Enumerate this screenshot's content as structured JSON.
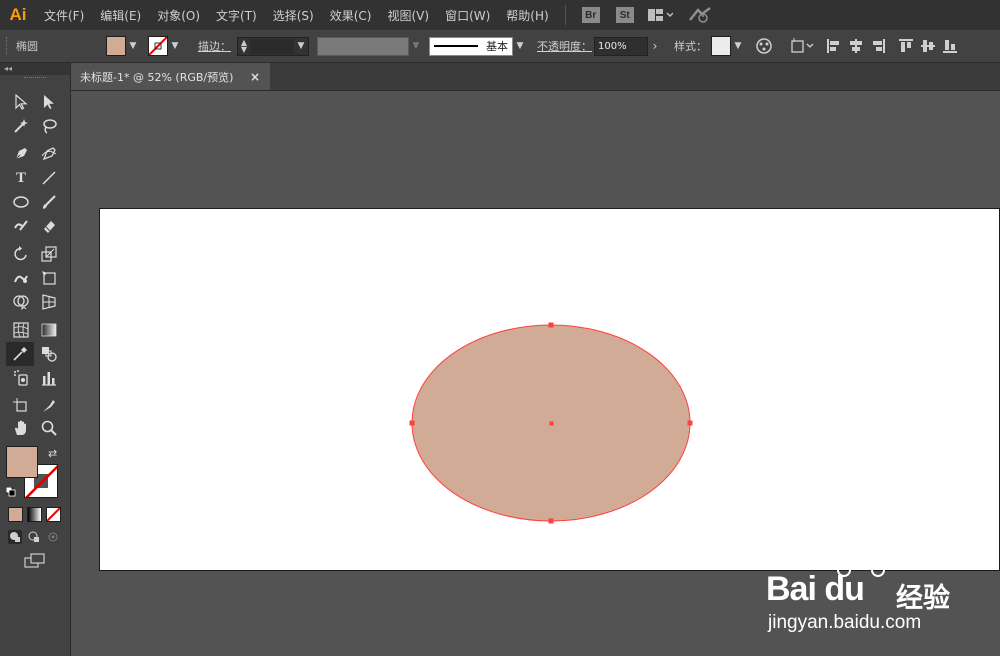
{
  "app": {
    "logo": "Ai"
  },
  "menu": {
    "items": [
      "文件(F)",
      "编辑(E)",
      "对象(O)",
      "文字(T)",
      "选择(S)",
      "效果(C)",
      "视图(V)",
      "窗口(W)",
      "帮助(H)"
    ],
    "bridge_badge": "Br",
    "stock_badge": "St"
  },
  "control": {
    "object_name": "椭圆",
    "stroke_label": "描边：",
    "stroke_style": "基本",
    "opacity_label": "不透明度：",
    "opacity_value": "100%",
    "style_label": "样式："
  },
  "document": {
    "tab_title": "未标题-1* @ 52% (RGB/预览)",
    "close_glyph": "×"
  },
  "colors": {
    "fill": "#d1ab95",
    "path_stroke": "#ff4040",
    "menubar": "#323232",
    "panel": "#424242",
    "canvas": "#535353",
    "artboard": "#ffffff",
    "accent": "#ff9a00"
  },
  "toolbox": {
    "collapse_glyph": "◂◂",
    "type_glyph": "T",
    "tools": [
      "selection",
      "direct-selection",
      "magic-wand",
      "lasso",
      "pen",
      "curvature",
      "type",
      "line-segment",
      "ellipse",
      "paintbrush",
      "shaper",
      "eraser",
      "rotate",
      "scale",
      "warp",
      "free-transform",
      "shape-builder",
      "perspective-grid",
      "mesh",
      "gradient",
      "eyedropper",
      "blend",
      "symbol-sprayer",
      "column-graph",
      "artboard",
      "slice",
      "hand",
      "zoom"
    ]
  },
  "watermark": {
    "brand": "Bai du",
    "brand_suffix": "经验",
    "url": "jingyan.baidu.com"
  }
}
